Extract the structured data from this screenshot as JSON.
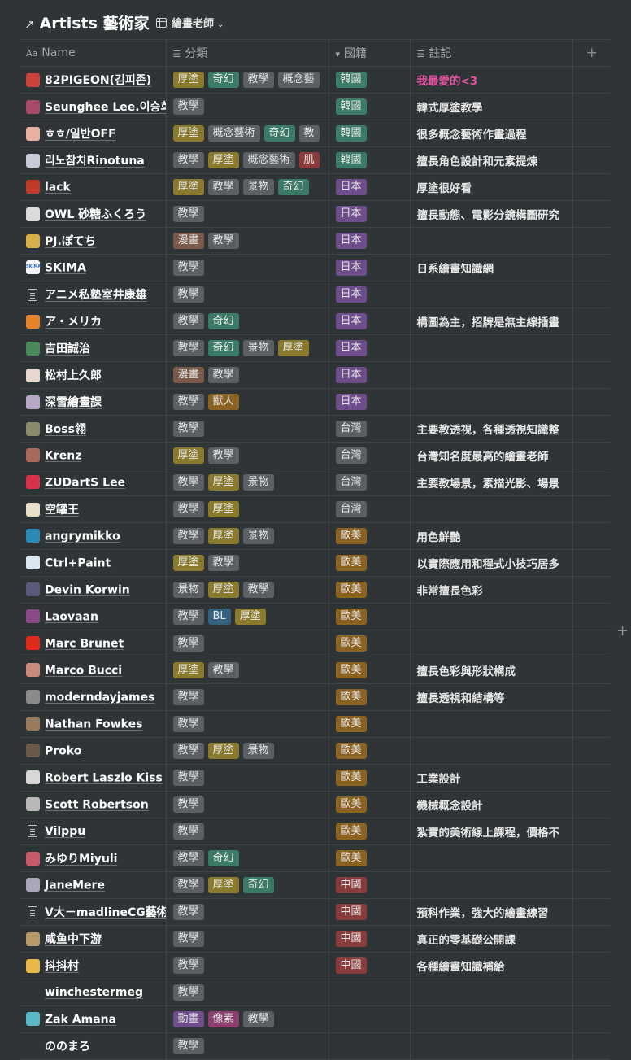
{
  "header": {
    "title": "Artists 藝術家",
    "view_label": "繪畫老師"
  },
  "columns": [
    {
      "label": "Name",
      "icon": "Aa"
    },
    {
      "label": "分類",
      "icon": "☰"
    },
    {
      "label": "國籍",
      "icon": "▾"
    },
    {
      "label": "註記",
      "icon": "☰"
    }
  ],
  "tag_colors": {
    "厚塗": "#8a7a2e",
    "奇幻": "#3c7a68",
    "教學": "#5c6064",
    "概念藝術": "#5c6064",
    "景物": "#5c6064",
    "漫畫": "#7a5a4a",
    "獸人": "#8a6222",
    "BL": "#35607e",
    "動畫": "#6e4e8a",
    "像素": "#8a3f6e",
    "肌": "#8a3c3c",
    "韓國": "#3c7a68",
    "日本": "#6e4e8a",
    "台灣": "#5c6064",
    "歐美": "#8a6222",
    "中國": "#8a3c3c"
  },
  "rows": [
    {
      "name": "82PIGEON(김피존)",
      "avatar": "#c9443a",
      "tags": [
        "厚塗",
        "奇幻",
        "教學",
        "概念藝"
      ],
      "country": "韓國",
      "note": "我最愛的<3",
      "note_color": "pink"
    },
    {
      "name": "Seunghee Lee.이승희",
      "avatar": "#a84a6a",
      "tags": [
        "教學"
      ],
      "country": "韓國",
      "note": "韓式厚塗教學"
    },
    {
      "name": "ㅎㅎ/일반OFF",
      "avatar": "#e8b0a0",
      "tags": [
        "厚塗",
        "概念藝術",
        "奇幻",
        "教"
      ],
      "country": "韓國",
      "note": "很多概念藝術作畫過程"
    },
    {
      "name": "리노참치Rinotuna",
      "avatar": "#c8ccd8",
      "tags": [
        "教學",
        "厚塗",
        "概念藝術",
        "肌"
      ],
      "country": "韓國",
      "note": "擅長角色設計和元素提煉"
    },
    {
      "name": "lack",
      "avatar": "#c23a2a",
      "tags": [
        "厚塗",
        "教學",
        "景物",
        "奇幻"
      ],
      "country": "日本",
      "note": "厚塗很好看"
    },
    {
      "name": "OWL 砂糖ふくろう",
      "avatar": "#dcdcdc",
      "tags": [
        "教學"
      ],
      "country": "日本",
      "note": "擅長動態、電影分鏡構圖研究"
    },
    {
      "name": "PJ.ぽてち",
      "avatar": "#d8b04a",
      "tags": [
        "漫畫",
        "教學"
      ],
      "country": "日本",
      "note": ""
    },
    {
      "name": "SKIMA",
      "avatar": "#f2f6fa",
      "avatar_text": "SKIMA",
      "tags": [
        "教學"
      ],
      "country": "日本",
      "note": "日系繪畫知識網"
    },
    {
      "name": "アニメ私塾室井康雄",
      "avatar": "doc",
      "tags": [
        "教學"
      ],
      "country": "日本",
      "note": ""
    },
    {
      "name": "ア・メリカ",
      "avatar": "#e8822a",
      "tags": [
        "教學",
        "奇幻"
      ],
      "country": "日本",
      "note": "構圖為主，招牌是無主線插畫"
    },
    {
      "name": "吉田誠治",
      "avatar": "#4a8a5a",
      "tags": [
        "教學",
        "奇幻",
        "景物",
        "厚塗"
      ],
      "country": "日本",
      "note": ""
    },
    {
      "name": "松村上久郎",
      "avatar": "#e6d8d0",
      "tags": [
        "漫畫",
        "教學"
      ],
      "country": "日本",
      "note": ""
    },
    {
      "name": "深雪繪畫課",
      "avatar": "#b8a8c8",
      "tags": [
        "教學",
        "獸人"
      ],
      "country": "日本",
      "note": ""
    },
    {
      "name": "Boss翎",
      "avatar": "#8a8a6a",
      "tags": [
        "教學"
      ],
      "country": "台灣",
      "note": "主要教透視，各種透視知識整"
    },
    {
      "name": "Krenz",
      "avatar": "#a86a5a",
      "tags": [
        "厚塗",
        "教學"
      ],
      "country": "台灣",
      "note": "台灣知名度最高的繪畫老師"
    },
    {
      "name": "ZUDartS Lee",
      "avatar": "#d8324a",
      "tags": [
        "教學",
        "厚塗",
        "景物"
      ],
      "country": "台灣",
      "note": "主要教場景，素描光影、場景"
    },
    {
      "name": "空罐王",
      "avatar": "#e8e0c8",
      "tags": [
        "教學",
        "厚塗"
      ],
      "country": "台灣",
      "note": ""
    },
    {
      "name": "angrymikko",
      "avatar": "#2a8ab8",
      "tags": [
        "教學",
        "厚塗",
        "景物"
      ],
      "country": "歐美",
      "note": "用色鮮艷"
    },
    {
      "name": "Ctrl+Paint",
      "avatar": "#dce6f0",
      "tags": [
        "厚塗",
        "教學"
      ],
      "country": "歐美",
      "note": "以實際應用和程式小技巧居多"
    },
    {
      "name": "Devin Korwin",
      "avatar": "#5a5a7a",
      "tags": [
        "景物",
        "厚塗",
        "教學"
      ],
      "country": "歐美",
      "note": "非常擅長色彩"
    },
    {
      "name": "Laovaan",
      "avatar": "#8a4a8a",
      "tags": [
        "教學",
        "BL",
        "厚塗"
      ],
      "country": "歐美",
      "note": ""
    },
    {
      "name": "Marc Brunet",
      "avatar": "#e02a1a",
      "tags": [
        "教學"
      ],
      "country": "歐美",
      "note": ""
    },
    {
      "name": "Marco Bucci",
      "avatar": "#c88a7a",
      "tags": [
        "厚塗",
        "教學"
      ],
      "country": "歐美",
      "note": "擅長色彩與形狀構成"
    },
    {
      "name": "moderndayjames",
      "avatar": "#8a8a8a",
      "tags": [
        "教學"
      ],
      "country": "歐美",
      "note": "擅長透視和結構等"
    },
    {
      "name": "Nathan Fowkes",
      "avatar": "#9a7a5a",
      "tags": [
        "教學"
      ],
      "country": "歐美",
      "note": ""
    },
    {
      "name": "Proko",
      "avatar": "#6a5a4a",
      "tags": [
        "教學",
        "厚塗",
        "景物"
      ],
      "country": "歐美",
      "note": ""
    },
    {
      "name": "Robert Laszlo Kiss",
      "avatar": "#d8d8d8",
      "tags": [
        "教學"
      ],
      "country": "歐美",
      "note": "工業設計"
    },
    {
      "name": "Scott Robertson",
      "avatar": "#b8b8b8",
      "tags": [
        "教學"
      ],
      "country": "歐美",
      "note": "機械概念設計"
    },
    {
      "name": "Vilppu",
      "avatar": "doc",
      "tags": [
        "教學"
      ],
      "country": "歐美",
      "note": "紮實的美術線上課程，價格不"
    },
    {
      "name": "みゆりMiyuli",
      "avatar": "#c85a6a",
      "tags": [
        "教學",
        "奇幻"
      ],
      "country": "歐美",
      "note": ""
    },
    {
      "name": "JaneMere",
      "avatar": "#a8a8b8",
      "tags": [
        "教學",
        "厚塗",
        "奇幻"
      ],
      "country": "中國",
      "note": ""
    },
    {
      "name": "V大－madlineCG藝術",
      "avatar": "doc",
      "tags": [
        "教學"
      ],
      "country": "中國",
      "note": "預科作業，強大的繪畫練習"
    },
    {
      "name": "咸鱼中下游",
      "avatar": "#b89a6a",
      "tags": [
        "教學"
      ],
      "country": "中國",
      "note": "真正的零基礎公開課"
    },
    {
      "name": "抖抖村",
      "avatar": "#e8b84a",
      "tags": [
        "教學"
      ],
      "country": "中國",
      "note": "各種繪畫知識補給"
    },
    {
      "name": "winchestermeg",
      "avatar": "none",
      "tags": [
        "教學"
      ],
      "country": "",
      "note": ""
    },
    {
      "name": "Zak Amana",
      "avatar": "#5ab8c8",
      "tags": [
        "動畫",
        "像素",
        "教學"
      ],
      "country": "",
      "note": ""
    },
    {
      "name": "ののまろ",
      "avatar": "none",
      "tags": [
        "教學"
      ],
      "country": "",
      "note": ""
    }
  ]
}
